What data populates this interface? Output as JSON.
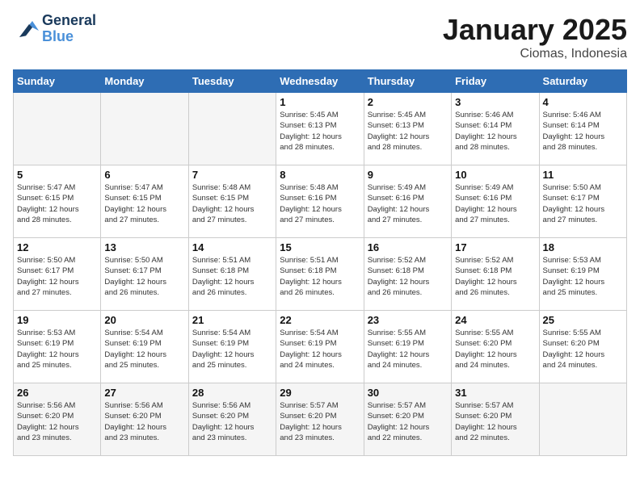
{
  "header": {
    "logo_line1": "General",
    "logo_line2": "Blue",
    "title": "January 2025",
    "subtitle": "Ciomas, Indonesia"
  },
  "weekdays": [
    "Sunday",
    "Monday",
    "Tuesday",
    "Wednesday",
    "Thursday",
    "Friday",
    "Saturday"
  ],
  "weeks": [
    [
      {
        "day": "",
        "info": ""
      },
      {
        "day": "",
        "info": ""
      },
      {
        "day": "",
        "info": ""
      },
      {
        "day": "1",
        "info": "Sunrise: 5:45 AM\nSunset: 6:13 PM\nDaylight: 12 hours\nand 28 minutes."
      },
      {
        "day": "2",
        "info": "Sunrise: 5:45 AM\nSunset: 6:13 PM\nDaylight: 12 hours\nand 28 minutes."
      },
      {
        "day": "3",
        "info": "Sunrise: 5:46 AM\nSunset: 6:14 PM\nDaylight: 12 hours\nand 28 minutes."
      },
      {
        "day": "4",
        "info": "Sunrise: 5:46 AM\nSunset: 6:14 PM\nDaylight: 12 hours\nand 28 minutes."
      }
    ],
    [
      {
        "day": "5",
        "info": "Sunrise: 5:47 AM\nSunset: 6:15 PM\nDaylight: 12 hours\nand 28 minutes."
      },
      {
        "day": "6",
        "info": "Sunrise: 5:47 AM\nSunset: 6:15 PM\nDaylight: 12 hours\nand 27 minutes."
      },
      {
        "day": "7",
        "info": "Sunrise: 5:48 AM\nSunset: 6:15 PM\nDaylight: 12 hours\nand 27 minutes."
      },
      {
        "day": "8",
        "info": "Sunrise: 5:48 AM\nSunset: 6:16 PM\nDaylight: 12 hours\nand 27 minutes."
      },
      {
        "day": "9",
        "info": "Sunrise: 5:49 AM\nSunset: 6:16 PM\nDaylight: 12 hours\nand 27 minutes."
      },
      {
        "day": "10",
        "info": "Sunrise: 5:49 AM\nSunset: 6:16 PM\nDaylight: 12 hours\nand 27 minutes."
      },
      {
        "day": "11",
        "info": "Sunrise: 5:50 AM\nSunset: 6:17 PM\nDaylight: 12 hours\nand 27 minutes."
      }
    ],
    [
      {
        "day": "12",
        "info": "Sunrise: 5:50 AM\nSunset: 6:17 PM\nDaylight: 12 hours\nand 27 minutes."
      },
      {
        "day": "13",
        "info": "Sunrise: 5:50 AM\nSunset: 6:17 PM\nDaylight: 12 hours\nand 26 minutes."
      },
      {
        "day": "14",
        "info": "Sunrise: 5:51 AM\nSunset: 6:18 PM\nDaylight: 12 hours\nand 26 minutes."
      },
      {
        "day": "15",
        "info": "Sunrise: 5:51 AM\nSunset: 6:18 PM\nDaylight: 12 hours\nand 26 minutes."
      },
      {
        "day": "16",
        "info": "Sunrise: 5:52 AM\nSunset: 6:18 PM\nDaylight: 12 hours\nand 26 minutes."
      },
      {
        "day": "17",
        "info": "Sunrise: 5:52 AM\nSunset: 6:18 PM\nDaylight: 12 hours\nand 26 minutes."
      },
      {
        "day": "18",
        "info": "Sunrise: 5:53 AM\nSunset: 6:19 PM\nDaylight: 12 hours\nand 25 minutes."
      }
    ],
    [
      {
        "day": "19",
        "info": "Sunrise: 5:53 AM\nSunset: 6:19 PM\nDaylight: 12 hours\nand 25 minutes."
      },
      {
        "day": "20",
        "info": "Sunrise: 5:54 AM\nSunset: 6:19 PM\nDaylight: 12 hours\nand 25 minutes."
      },
      {
        "day": "21",
        "info": "Sunrise: 5:54 AM\nSunset: 6:19 PM\nDaylight: 12 hours\nand 25 minutes."
      },
      {
        "day": "22",
        "info": "Sunrise: 5:54 AM\nSunset: 6:19 PM\nDaylight: 12 hours\nand 24 minutes."
      },
      {
        "day": "23",
        "info": "Sunrise: 5:55 AM\nSunset: 6:19 PM\nDaylight: 12 hours\nand 24 minutes."
      },
      {
        "day": "24",
        "info": "Sunrise: 5:55 AM\nSunset: 6:20 PM\nDaylight: 12 hours\nand 24 minutes."
      },
      {
        "day": "25",
        "info": "Sunrise: 5:55 AM\nSunset: 6:20 PM\nDaylight: 12 hours\nand 24 minutes."
      }
    ],
    [
      {
        "day": "26",
        "info": "Sunrise: 5:56 AM\nSunset: 6:20 PM\nDaylight: 12 hours\nand 23 minutes."
      },
      {
        "day": "27",
        "info": "Sunrise: 5:56 AM\nSunset: 6:20 PM\nDaylight: 12 hours\nand 23 minutes."
      },
      {
        "day": "28",
        "info": "Sunrise: 5:56 AM\nSunset: 6:20 PM\nDaylight: 12 hours\nand 23 minutes."
      },
      {
        "day": "29",
        "info": "Sunrise: 5:57 AM\nSunset: 6:20 PM\nDaylight: 12 hours\nand 23 minutes."
      },
      {
        "day": "30",
        "info": "Sunrise: 5:57 AM\nSunset: 6:20 PM\nDaylight: 12 hours\nand 22 minutes."
      },
      {
        "day": "31",
        "info": "Sunrise: 5:57 AM\nSunset: 6:20 PM\nDaylight: 12 hours\nand 22 minutes."
      },
      {
        "day": "",
        "info": ""
      }
    ]
  ]
}
